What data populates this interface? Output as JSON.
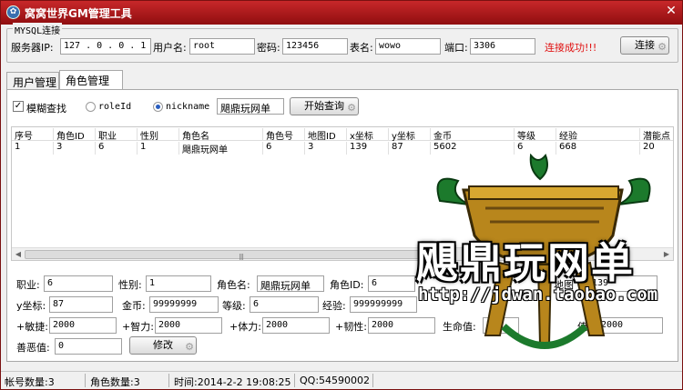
{
  "window": {
    "title": "窝窝世界GM管理工具",
    "close": "✕"
  },
  "mysql": {
    "caption": "MYSQL连接",
    "server_label": "服务器IP:",
    "server_value": "127 . 0  . 0  . 1",
    "user_label": "用户名:",
    "user_value": "root",
    "pass_label": "密码:",
    "pass_value": "123456",
    "table_label": "表名:",
    "table_value": "wowo",
    "port_label": "端口:",
    "port_value": "3306",
    "status": "连接成功!!!",
    "connect_label": "连接"
  },
  "tabs": [
    "用户管理",
    "角色管理"
  ],
  "search": {
    "fuzzy_label": "模糊查找",
    "fuzzy_checked": true,
    "roleid_label": "roleId",
    "nickname_label": "nickname",
    "query_value": "飓鼎玩网单",
    "start_label": "开始查询"
  },
  "grid": {
    "columns": [
      "序号",
      "角色ID",
      "职业",
      "性别",
      "角色名",
      "角色号",
      "地图ID",
      "x坐标",
      "y坐标",
      "金币",
      "等级",
      "经验",
      "潜能点"
    ],
    "rows": [
      [
        "1",
        "3",
        "6",
        "1",
        "飓鼎玩网单",
        "6",
        "3",
        "139",
        "87",
        "5602",
        "6",
        "668",
        "20"
      ]
    ],
    "scroll_grip": "|||"
  },
  "edit": {
    "job_label": "职业:",
    "job_value": "6",
    "sex_label": "性别:",
    "sex_value": "1",
    "name_label": "角色名:",
    "name_value": "飓鼎玩网单",
    "roleid_label": "角色ID:",
    "roleid_value": "6",
    "map_label": "地图",
    "map_value": "",
    "x_value": "139",
    "y_label": "y坐标:",
    "y_value": "87",
    "gold_label": "金币:",
    "gold_value": "99999999",
    "level_label": "等级:",
    "level_value": "6",
    "exp_label": "经验:",
    "exp_value": "999999999",
    "agi_label": "+敏捷:",
    "agi_value": "2000",
    "int_label": "+智力:",
    "int_value": "2000",
    "con_label": "+体力:",
    "con_value": "2000",
    "tough_label": "+韧性:",
    "tough_value": "2000",
    "hp_label": "生命值:",
    "hp_value": "200",
    "mp_label": "值:",
    "mp_value": "2000",
    "karma_label": "善恶值:",
    "karma_value": "0",
    "modify_label": "修改"
  },
  "watermark": {
    "text": "飓鼎玩网单",
    "url": "http://jdwan.taobao.com"
  },
  "statusbar": {
    "accounts": "帐号数量:3",
    "roles": "角色数量:3",
    "time": "时间:2014-2-2 19:08:25",
    "qq": "QQ:54590002"
  },
  "colors": {
    "title_bar": "#b01a1c",
    "status_ok": "#e01010",
    "accent_blue": "#2a5ec0"
  },
  "icons": [
    "app-icon",
    "close-icon",
    "gear-icon",
    "check-icon"
  ]
}
